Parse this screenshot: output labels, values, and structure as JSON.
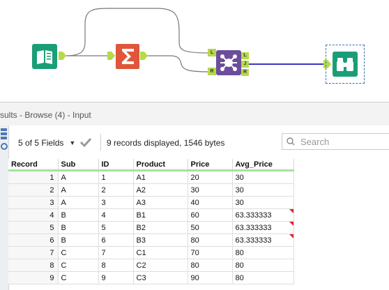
{
  "results": {
    "title": "sults - Browse (4) - Input"
  },
  "toolbar": {
    "fields_label": "5 of 5 Fields",
    "record_info": "9 records displayed, 1546 bytes",
    "search_placeholder": "Search"
  },
  "workflow": {
    "anchors": {
      "left": "L",
      "right": "R",
      "join": "J"
    },
    "tools": [
      {
        "name": "Input",
        "icon": "book-icon",
        "color": "#1a9e78"
      },
      {
        "name": "Summarize",
        "icon": "sigma-icon",
        "color": "#e0563b"
      },
      {
        "name": "Join",
        "icon": "join-icon",
        "color": "#6b4d9b"
      },
      {
        "name": "Browse",
        "icon": "binoculars-icon",
        "color": "#1a9e78"
      }
    ]
  },
  "grid": {
    "columns": [
      "Record",
      "Sub",
      "ID",
      "Product",
      "Price",
      "Avg_Price"
    ],
    "rows": [
      {
        "record": "1",
        "sub": "A",
        "id": "1",
        "product": "A1",
        "price": "20",
        "avg": "30"
      },
      {
        "record": "2",
        "sub": "A",
        "id": "2",
        "product": "A2",
        "price": "30",
        "avg": "30"
      },
      {
        "record": "3",
        "sub": "A",
        "id": "3",
        "product": "A3",
        "price": "40",
        "avg": "30"
      },
      {
        "record": "4",
        "sub": "B",
        "id": "4",
        "product": "B1",
        "price": "60",
        "avg": "63.333333",
        "truncated": true
      },
      {
        "record": "5",
        "sub": "B",
        "id": "5",
        "product": "B2",
        "price": "50",
        "avg": "63.333333",
        "truncated": true
      },
      {
        "record": "6",
        "sub": "B",
        "id": "6",
        "product": "B3",
        "price": "80",
        "avg": "63.333333",
        "truncated": true
      },
      {
        "record": "7",
        "sub": "C",
        "id": "7",
        "product": "C1",
        "price": "70",
        "avg": "80"
      },
      {
        "record": "8",
        "sub": "C",
        "id": "8",
        "product": "C2",
        "price": "80",
        "avg": "80"
      },
      {
        "record": "9",
        "sub": "C",
        "id": "9",
        "product": "C3",
        "price": "90",
        "avg": "80"
      }
    ]
  },
  "colors": {
    "accent_green": "#1a9e78",
    "summarize_orange": "#e0563b",
    "join_purple": "#6b4d9b",
    "connector_blue": "#3b35c0",
    "header_underline": "#a6e39d",
    "truncation_flag": "#d8232a"
  }
}
